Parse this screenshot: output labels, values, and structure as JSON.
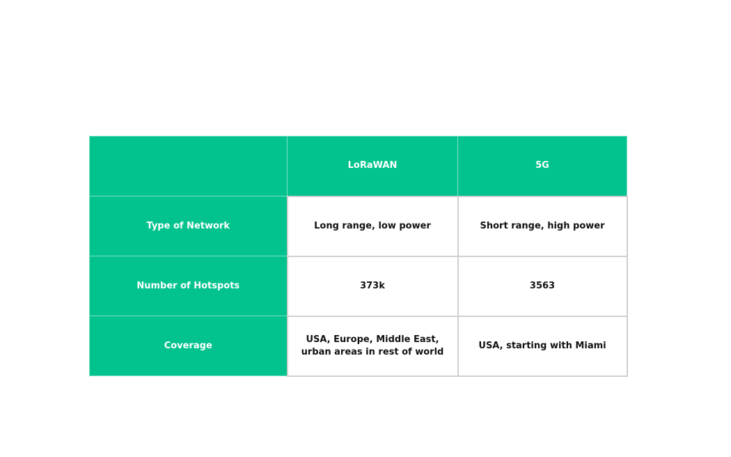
{
  "table": {
    "header": {
      "corner": "",
      "columns": [
        "LoRaWAN",
        "5G"
      ]
    },
    "rows": [
      {
        "label": "Type of Network",
        "values": [
          "Long range, low power",
          "Short range, high power"
        ]
      },
      {
        "label": "Number of Hotspots",
        "values": [
          "373k",
          "3563"
        ]
      },
      {
        "label": "Coverage",
        "values": [
          "USA, Europe, Middle East, urban areas in rest of world",
          "USA, starting with Miami"
        ]
      }
    ]
  },
  "colors": {
    "accent_green": "#02c38d",
    "header_text": "#ffffff",
    "body_text": "#111111",
    "cell_border": "#cfcfcf"
  }
}
